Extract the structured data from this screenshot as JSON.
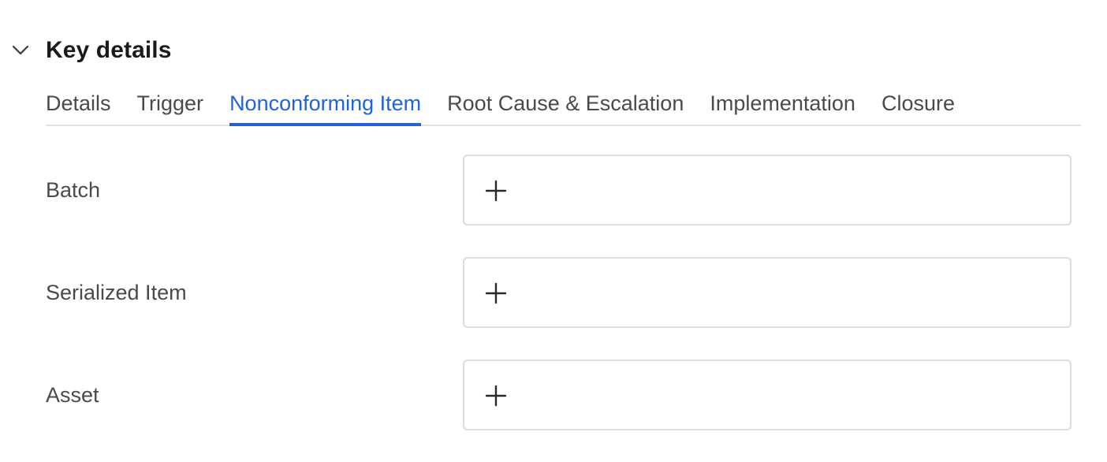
{
  "section": {
    "title": "Key details",
    "expanded": true
  },
  "tabs": [
    {
      "label": "Details",
      "active": false
    },
    {
      "label": "Trigger",
      "active": false
    },
    {
      "label": "Nonconforming Item",
      "active": true
    },
    {
      "label": "Root Cause & Escalation",
      "active": false
    },
    {
      "label": "Implementation",
      "active": false
    },
    {
      "label": "Closure",
      "active": false
    }
  ],
  "fields": [
    {
      "label": "Batch",
      "icon": "plus-icon"
    },
    {
      "label": "Serialized Item",
      "icon": "plus-icon"
    },
    {
      "label": "Asset",
      "icon": "plus-icon"
    }
  ],
  "colors": {
    "accent": "#1f63d6",
    "text": "#1b1b1d",
    "muted": "#4a4a4e",
    "border": "#dcdcdf"
  }
}
